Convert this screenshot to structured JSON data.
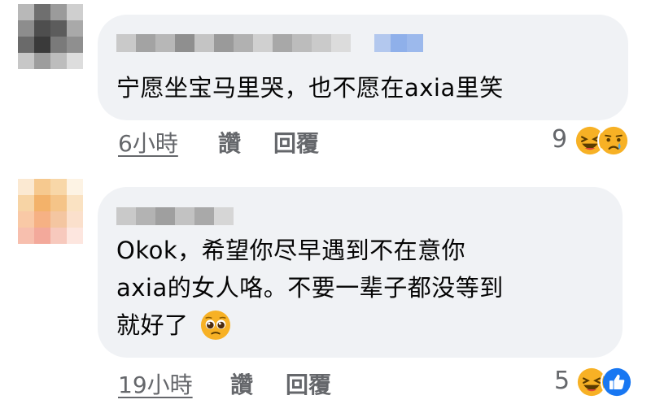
{
  "comments": [
    {
      "text": "宁愿坐宝马里哭，也不愿在axia里笑",
      "time": "6小時",
      "like_label": "讚",
      "reply_label": "回覆",
      "reaction_count": "9",
      "reactions": [
        "laughing-emoji",
        "crying-emoji"
      ]
    },
    {
      "text_line1": "Okok，希望你尽早遇到不在意你",
      "text_line2": "axia的女人咯。不要一辈子都没等到",
      "text_line3": "就好了",
      "inline_emoji": "pleading-face-emoji",
      "time": "19小時",
      "like_label": "讚",
      "reply_label": "回覆",
      "reaction_count": "5",
      "reactions": [
        "laughing-emoji",
        "like-emoji"
      ]
    }
  ],
  "colors": {
    "bubble": "#f0f2f5",
    "text": "#050505",
    "meta": "#65676b",
    "like_blue": "#1877f2",
    "emoji_yellow": "#f7b125"
  }
}
